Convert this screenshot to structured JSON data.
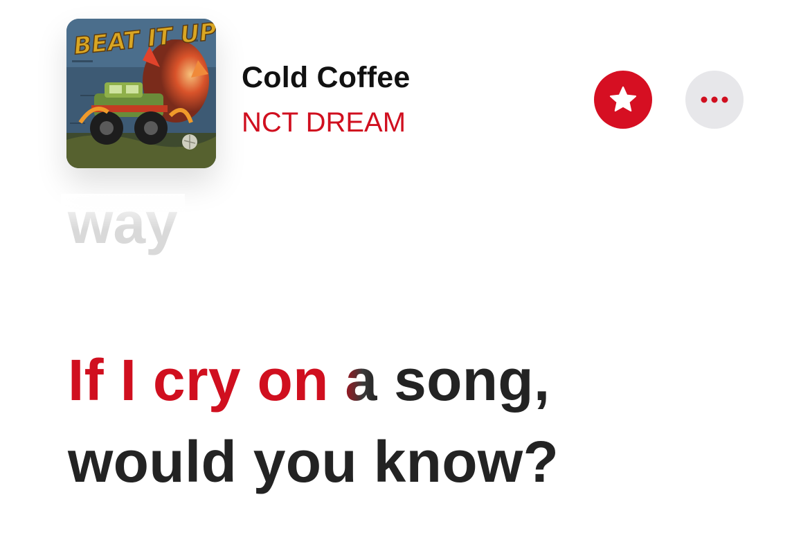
{
  "now_playing": {
    "artwork": {
      "title_text": "BEAT IT UP",
      "accent_color": "#d9a623"
    },
    "song_title": "Cold Coffee",
    "artist": "NCT DREAM",
    "favorite_icon": "star-icon",
    "more_icon": "ellipsis-icon"
  },
  "lyrics": {
    "previous_line_tail": "way",
    "current_line": {
      "words": [
        {
          "text": "If",
          "state": "sung"
        },
        {
          "text": "I",
          "state": "sung"
        },
        {
          "text": "cry",
          "state": "sung"
        },
        {
          "text": "on",
          "state": "sung"
        },
        {
          "text": "a",
          "state": "fading"
        },
        {
          "text": "song,",
          "state": "upcoming"
        }
      ],
      "second_line": "would you know?"
    }
  },
  "colors": {
    "accent": "#d00f1f",
    "favorite_button": "#d60f22",
    "more_button": "#e7e7ea",
    "lyric_text": "#232323",
    "previous_line": "#d9d9d9"
  }
}
